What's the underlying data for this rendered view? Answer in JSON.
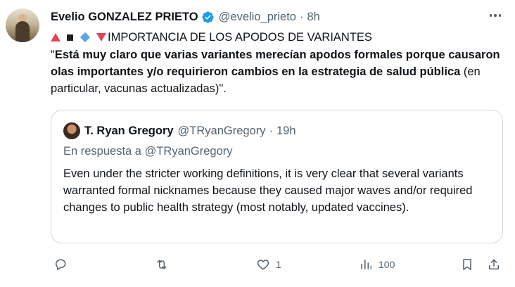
{
  "tweet": {
    "author_name": "Evelio GONZALEZ PRIETO",
    "handle": "@evelio_prieto",
    "separator": "·",
    "time": "8h",
    "heading": "IMPORTANCIA DE LOS APODOS DE VARIANTES",
    "quote_open": "\"",
    "bold_text": "Está muy claro que varias variantes merecían apodos formales porque causaron olas importantes y/o requirieron cambios en la estrategia de salud pública",
    "normal_text": " (en particular, vacunas actualizadas)\".",
    "icons": [
      "red-triangle-up-icon",
      "black-square-icon",
      "blue-diamond-icon",
      "red-triangle-down-icon"
    ]
  },
  "quoted": {
    "author_name": "T. Ryan Gregory",
    "handle": "@TRyanGregory",
    "separator": "·",
    "time": "19h",
    "reply_to": "En respuesta a @TRyanGregory",
    "text": "Even under the stricter working definitions, it is very clear that several variants warranted formal nicknames because they caused major waves and/or required changes to public health strategy (most notably, updated vaccines)."
  },
  "actions": {
    "like_count": "1",
    "views_count": "100"
  },
  "colors": {
    "text": "#0f1419",
    "secondary": "#536471",
    "verified": "#1d9bf0",
    "border": "#cfd9de"
  }
}
